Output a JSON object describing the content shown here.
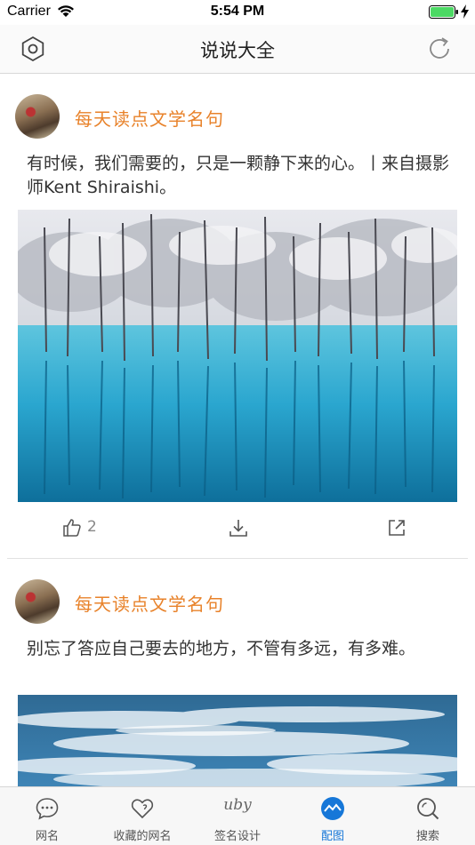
{
  "status_bar": {
    "carrier": "Carrier",
    "time": "5:54 PM"
  },
  "nav": {
    "title": "说说大全",
    "left_icon": "settings-hexagon-icon",
    "right_icon": "refresh-icon"
  },
  "posts": [
    {
      "author": "每天读点文学名句",
      "text": "有时候，我们需要的，只是一颗静下来的心。丨来自摄影师Kent Shiraishi。",
      "likes": "2",
      "image": "snowy-trees-blue-lake-photo"
    },
    {
      "author": "每天读点文学名句",
      "text": "别忘了答应自己要去的地方，不管有多远，有多难。",
      "image": "sky-clouds-photo"
    }
  ],
  "tabs": [
    {
      "label": "网名",
      "icon": "chat-bubble-icon"
    },
    {
      "label": "收藏的网名",
      "icon": "heart-icon"
    },
    {
      "label": "签名设计",
      "icon": "signature-icon",
      "glyph_text": "uby"
    },
    {
      "label": "配图",
      "icon": "image-wave-icon",
      "active": true
    },
    {
      "label": "搜索",
      "icon": "search-icon"
    }
  ],
  "colors": {
    "accent_orange": "#e8822a",
    "active_tab": "#1677d8"
  }
}
